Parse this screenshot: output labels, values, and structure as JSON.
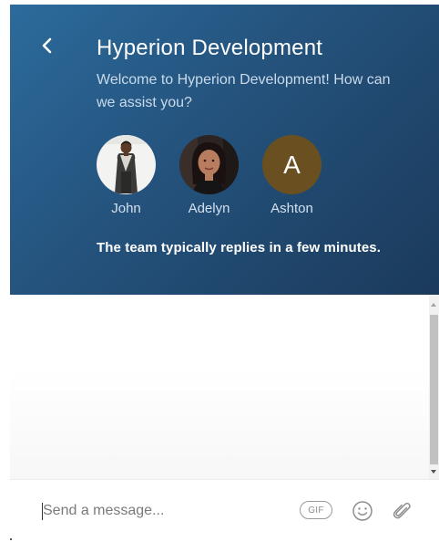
{
  "header": {
    "back_icon": "chevron-left-icon",
    "title": "Hyperion Development",
    "intro": "Welcome to Hyperion Development! How can we assist you?",
    "team": [
      {
        "name": "John",
        "avatar": "photo"
      },
      {
        "name": "Adelyn",
        "avatar": "photo"
      },
      {
        "name": "Ashton",
        "avatar": "letter",
        "initial": "A",
        "color": "#6a4f21"
      }
    ],
    "reply_time": "The team typically replies in a few minutes.",
    "gradient_colors": [
      "#2c6b9c",
      "#1b3a5b"
    ]
  },
  "composer": {
    "placeholder": "Send a message...",
    "gif_label": "GIF",
    "emoji_icon": "smiley-icon",
    "attach_icon": "paperclip-icon"
  }
}
